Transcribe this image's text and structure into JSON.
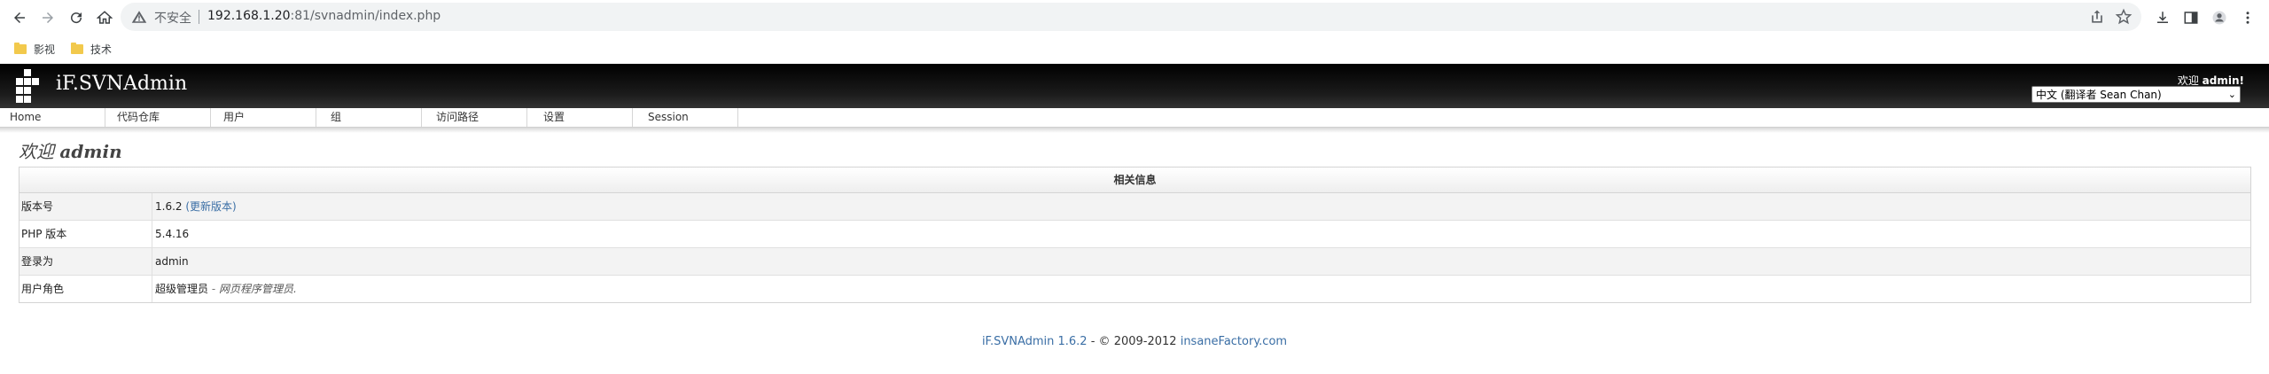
{
  "browser": {
    "insecure_label": "不安全",
    "url_host": "192.168.1.20",
    "url_rest": ":81/svnadmin/index.php",
    "bookmarks": [
      {
        "label": "影视"
      },
      {
        "label": "技术"
      }
    ]
  },
  "header": {
    "app_title": "iF.SVNAdmin",
    "welcome_prefix": "欢迎",
    "welcome_user": "admin!",
    "language_selected": "中文 (翻译者 Sean Chan)"
  },
  "nav": {
    "items": [
      {
        "label": "Home"
      },
      {
        "label": "代码仓库"
      },
      {
        "label": "用户"
      },
      {
        "label": "组"
      },
      {
        "label": "访问路径"
      },
      {
        "label": "设置"
      },
      {
        "label": "Session"
      }
    ]
  },
  "main": {
    "title_prefix": "欢迎",
    "title_user": "admin",
    "table": {
      "header": "相关信息",
      "rows": [
        {
          "label": "版本号",
          "value": "1.6.2",
          "link": "(更新版本)"
        },
        {
          "label": "PHP 版本",
          "value": "5.4.16"
        },
        {
          "label": "登录为",
          "value": "admin"
        },
        {
          "label": "用户角色",
          "value": "超级管理员",
          "separator": "-",
          "description": "网页程序管理员."
        }
      ]
    }
  },
  "footer": {
    "product_link": "iF.SVNAdmin 1.6.2",
    "copyright": "- © 2009-2012",
    "company_link": "insaneFactory.com"
  },
  "colors": {
    "header_bg": "#000000",
    "link": "#3a6ea5",
    "row_alt": "#f3f3f3"
  }
}
